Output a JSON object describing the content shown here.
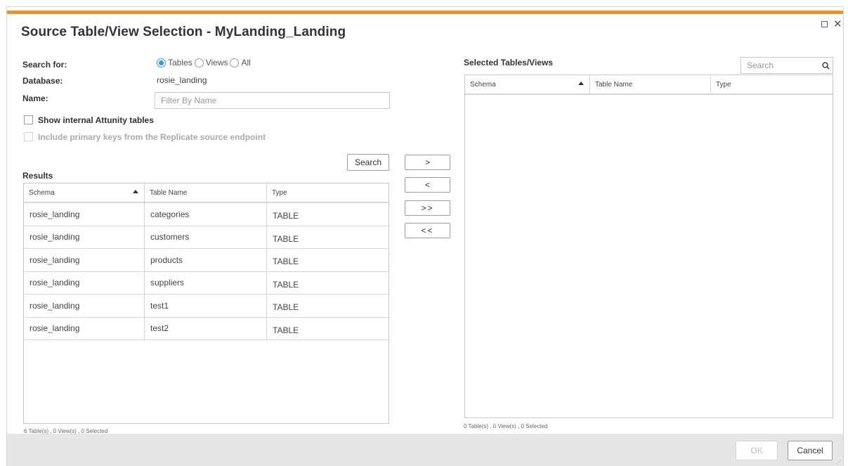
{
  "dialog": {
    "title": "Source Table/View Selection - MyLanding_Landing"
  },
  "search_panel": {
    "search_for_label": "Search for:",
    "options": [
      "Tables",
      "Views",
      "All"
    ],
    "selected_option": "Tables",
    "database_label": "Database:",
    "database_value": "rosie_landing",
    "name_label": "Name:",
    "name_placeholder": "Filter By Name",
    "show_internal_label": "Show internal Attunity tables",
    "include_pk_label": "Include primary keys from the Replicate source endpoint",
    "search_button": "Search"
  },
  "results": {
    "title": "Results",
    "columns": [
      "Schema",
      "Table Name",
      "Type"
    ],
    "rows": [
      [
        "rosie_landing",
        "categories",
        "TABLE"
      ],
      [
        "rosie_landing",
        "customers",
        "TABLE"
      ],
      [
        "rosie_landing",
        "products",
        "TABLE"
      ],
      [
        "rosie_landing",
        "suppliers",
        "TABLE"
      ],
      [
        "rosie_landing",
        "test1",
        "TABLE"
      ],
      [
        "rosie_landing",
        "test2",
        "TABLE"
      ]
    ],
    "status": "6 Table(s) , 0 View(s) , 0 Selected"
  },
  "transfer": {
    "add": ">",
    "remove": "<",
    "add_all": ">>",
    "remove_all": "<<"
  },
  "selected": {
    "title": "Selected Tables/Views",
    "search_placeholder": "Search",
    "columns": [
      "Schema",
      "Table Name",
      "Type"
    ],
    "status": "0 Table(s) , 0 View(s) , 0 Selected"
  },
  "buttons": {
    "ok": "OK",
    "cancel": "Cancel"
  },
  "colors": {
    "accent": "#f39021",
    "radio_selected": "#2d9cdb"
  }
}
